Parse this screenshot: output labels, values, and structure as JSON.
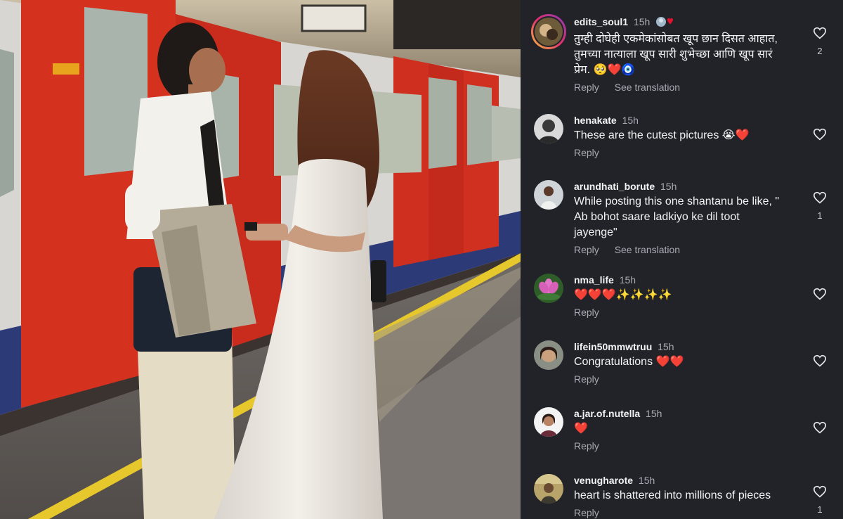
{
  "colors": {
    "background": "#212328",
    "text": "#f2f3f5",
    "muted": "#a8acb3",
    "heart": "#e0142d"
  },
  "photo": {
    "icon": "photo-image",
    "subject": "couple at underground train platform"
  },
  "comments": [
    {
      "username": "edits_soul1",
      "time": "15h",
      "text": "तुम्ही दोघेही एकमेकांसोबत खूप छान दिसत आहात,\nतुमच्या नात्याला खूप सारी शुभेच्छा आणि खूप सारं\nप्रेम. 🥺❤️🧿",
      "reply": "Reply",
      "translate": "See translation",
      "likes": "2"
    },
    {
      "username": "henakate",
      "time": "15h",
      "text": "These are the cutest pictures 😭❤️",
      "reply": "Reply",
      "translate": "",
      "likes": ""
    },
    {
      "username": "arundhati_borute",
      "time": "15h",
      "text": "While posting this one shantanu be like, \"\nAb bohot saare ladkiyo ke dil toot\njayenge\"",
      "reply": "Reply",
      "translate": "See translation",
      "likes": "1"
    },
    {
      "username": "nma_life",
      "time": "15h",
      "text": "❤️❤️❤️✨✨✨✨",
      "reply": "Reply",
      "translate": "",
      "likes": ""
    },
    {
      "username": "lifein50mmwtruu",
      "time": "15h",
      "text": "Congratulations ❤️❤️",
      "reply": "Reply",
      "translate": "",
      "likes": ""
    },
    {
      "username": "a.jar.of.nutella",
      "time": "15h",
      "text": "❤️",
      "reply": "Reply",
      "translate": "",
      "likes": ""
    },
    {
      "username": "venugharote",
      "time": "15h",
      "text": "heart is shattered into millions of pieces",
      "reply": "Reply",
      "translate": "",
      "likes": "1"
    }
  ]
}
